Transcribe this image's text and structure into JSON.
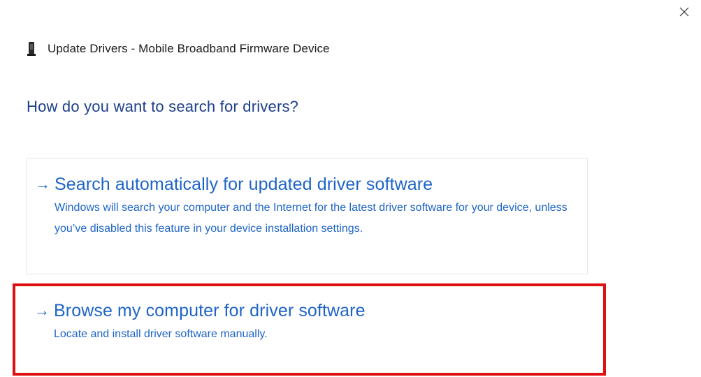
{
  "window": {
    "title": "Update Drivers - Mobile Broadband Firmware Device",
    "icon": "device-icon",
    "close_icon": "close-icon"
  },
  "heading": "How do you want to search for drivers?",
  "options": [
    {
      "title": "Search automatically for updated driver software",
      "description": "Windows will search your computer and the Internet for the latest driver software for your device, unless you’ve disabled this feature in your device installation settings.",
      "icon": "arrow-right-icon"
    },
    {
      "title": "Browse my computer for driver software",
      "description": "Locate and install driver software manually.",
      "icon": "arrow-right-icon",
      "highlighted": true
    }
  ],
  "colors": {
    "heading": "#1e3f8c",
    "link": "#1e64c8",
    "highlight": "#e01010",
    "border": "#dfe6ee"
  }
}
